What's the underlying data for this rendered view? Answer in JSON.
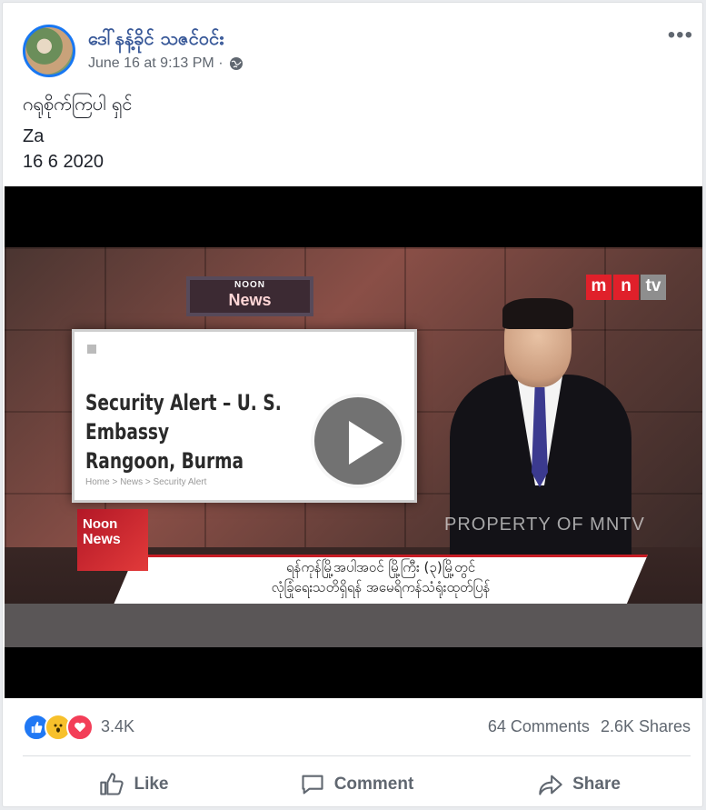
{
  "post": {
    "author": "ဒေါ်နန့်ခိုင် သဇင်ဝင်း",
    "timestamp": "June 16 at 9:13 PM ·",
    "privacy_icon": "globe-icon",
    "more_label": "•••",
    "lines": [
      "ဂရုစိုက်ကြပါ ရှင်",
      "Za",
      "16 6 2020"
    ]
  },
  "video": {
    "sign_small": "NOON",
    "sign_big": "News",
    "logo": [
      "m",
      "n",
      "tv"
    ],
    "screen_headline": [
      "Security Alert – U. S. Embassy",
      "Rangoon, Burma"
    ],
    "screen_crumb": "Home > News > Security Alert",
    "corner_box": [
      "Noon",
      "News"
    ],
    "watermark": "PROPERTY OF MNTV",
    "caption_line1": "ရန်ကုန်မြို့အပါအဝင် မြို့ကြီး (၃)မြို့တွင်",
    "caption_line2": "လုံခြုံရေးသတိရှိရန် အမေရိကန်သံရုံးထုတ်ပြန်",
    "play_icon": "play-icon"
  },
  "stats": {
    "reactions": [
      "like",
      "wow",
      "love"
    ],
    "reaction_count": "3.4K",
    "comments": "64 Comments",
    "shares": "2.6K Shares"
  },
  "actions": {
    "like": "Like",
    "comment": "Comment",
    "share": "Share"
  },
  "colors": {
    "link": "#385898",
    "meta": "#606770",
    "like_blue": "#2078f4"
  }
}
